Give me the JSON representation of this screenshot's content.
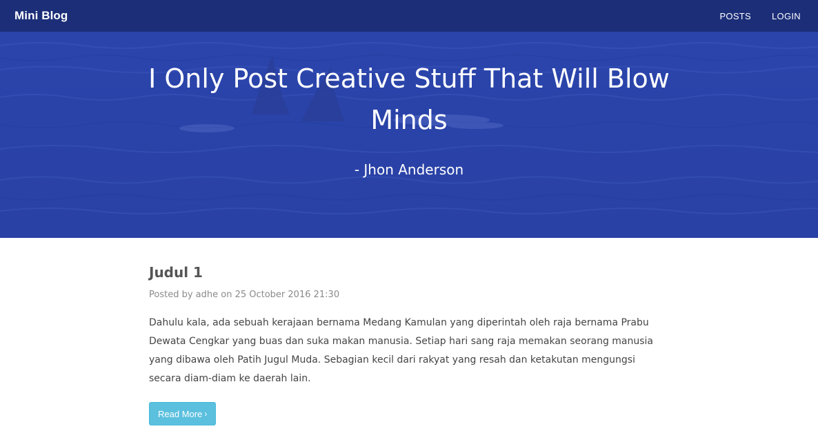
{
  "navbar": {
    "brand": "Mini Blog",
    "links": [
      "POSTS",
      "LOGIN"
    ]
  },
  "hero": {
    "title": "I Only Post Creative Stuff That Will Blow Minds",
    "quote": "- Jhon Anderson"
  },
  "post": {
    "title": "Judul 1",
    "meta": "Posted by adhe on 25 October 2016 21:30",
    "excerpt": "Dahulu kala, ada sebuah kerajaan bernama Medang Kamulan yang diperintah oleh raja bernama Prabu Dewata Cengkar yang buas dan suka makan manusia. Setiap hari sang raja memakan seorang manusia yang dibawa oleh Patih Jugul Muda. Sebagian kecil dari rakyat yang resah dan ketakutan mengungsi secara diam-diam ke daerah lain.",
    "read_more": "Read More",
    "read_more_icon": "chevron-right-icon"
  },
  "colors": {
    "navbar": "#1c2e78",
    "hero": "#2e48ad",
    "button": "#5bc0de"
  }
}
